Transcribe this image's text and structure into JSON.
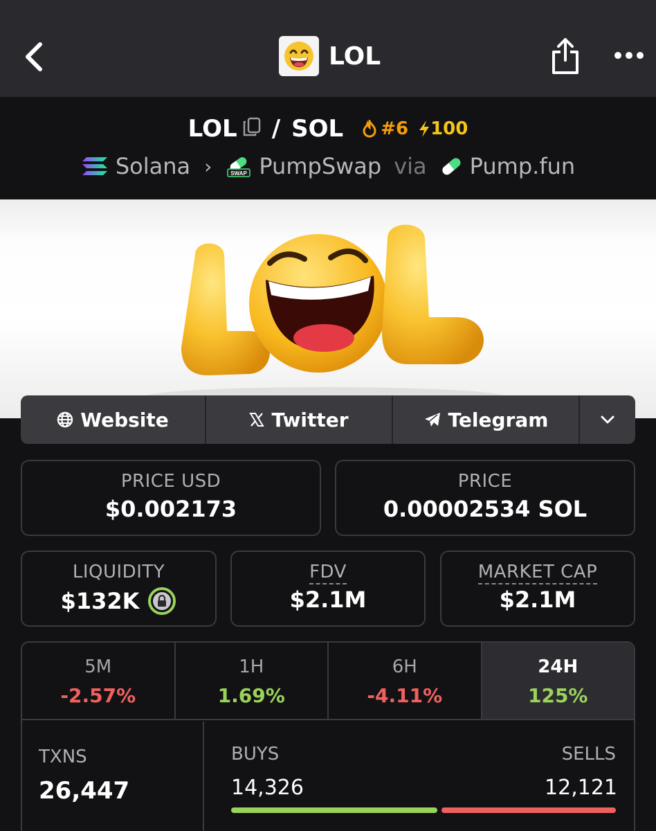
{
  "header": {
    "title": "LOL",
    "back_icon": "chevron-left-icon",
    "share_icon": "share-icon",
    "more_icon": "more-dots-icon"
  },
  "pair": {
    "base": "LOL",
    "quote": "SOL",
    "separator": "/",
    "rank": "#6",
    "boost": "100",
    "chain": "Solana",
    "dex": "PumpSwap",
    "via": "via",
    "launchpad": "Pump.fun"
  },
  "banner": {
    "text": "LOL"
  },
  "links": [
    {
      "label": "Website",
      "icon": "globe-icon"
    },
    {
      "label": "Twitter",
      "icon": "x-logo-icon"
    },
    {
      "label": "Telegram",
      "icon": "telegram-icon"
    }
  ],
  "price": {
    "usd_label": "PRICE USD",
    "usd_value": "$0.002173",
    "native_label": "PRICE",
    "native_value": "0.00002534 SOL"
  },
  "metrics": {
    "liquidity_label": "LIQUIDITY",
    "liquidity_value": "$132K",
    "fdv_label": "FDV",
    "fdv_value": "$2.1M",
    "mcap_label": "MARKET CAP",
    "mcap_value": "$2.1M"
  },
  "timeframes": [
    {
      "label": "5M",
      "value": "-2.57%",
      "trend": "neg"
    },
    {
      "label": "1H",
      "value": "1.69%",
      "trend": "pos"
    },
    {
      "label": "6H",
      "value": "-4.11%",
      "trend": "neg"
    },
    {
      "label": "24H",
      "value": "125%",
      "trend": "pos",
      "active": true
    }
  ],
  "txns": {
    "label": "TXNS",
    "value": "26,447",
    "buys_label": "BUYS",
    "buys_value": "14,326",
    "sells_label": "SELLS",
    "sells_value": "12,121",
    "buy_ratio": 0.5417
  },
  "colors": {
    "positive": "#9ad35b",
    "negative": "#f0615e",
    "rank": "#f59e0b",
    "boost": "#f5c518"
  }
}
